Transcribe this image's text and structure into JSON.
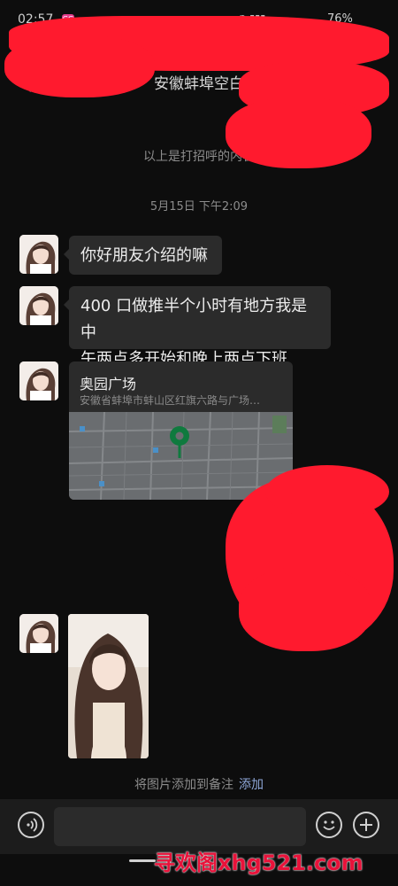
{
  "status_bar": {
    "time": "02:57",
    "app_badge": "GG",
    "battery": "76%"
  },
  "header": {
    "title": "安徽蚌埠空白"
  },
  "system_notice": "以上是打招呼的内容",
  "timestamp": "5月15日 下午2:09",
  "messages": [
    {
      "type": "text",
      "lines": [
        "你好朋友介绍的嘛"
      ]
    },
    {
      "type": "text",
      "lines": [
        "400 口做推半个小时有地方我是中",
        "午两点多开始和晚上两点下班"
      ]
    },
    {
      "type": "location",
      "title": "奥园广场",
      "address": "安徽省蚌埠市蚌山区红旗六路与广场…"
    },
    {
      "type": "image"
    }
  ],
  "photo_notice": {
    "text": "将图片添加到备注",
    "link": "添加"
  },
  "input": {
    "value": "",
    "placeholder": ""
  },
  "watermark": "寻欢阁xhg521.com",
  "colors": {
    "background": "#0d0d0d",
    "bubble": "#2b2b2b",
    "map_pin": "#0f7a3e",
    "link": "#8fa8d9",
    "redaction": "#ff1a2e",
    "watermark": "#e8123a"
  },
  "icons": {
    "back": "back-arrow-icon",
    "more": "more-icon",
    "voice": "voice-icon",
    "emoji": "emoji-icon",
    "plus": "plus-icon",
    "pin": "map-pin-icon"
  }
}
